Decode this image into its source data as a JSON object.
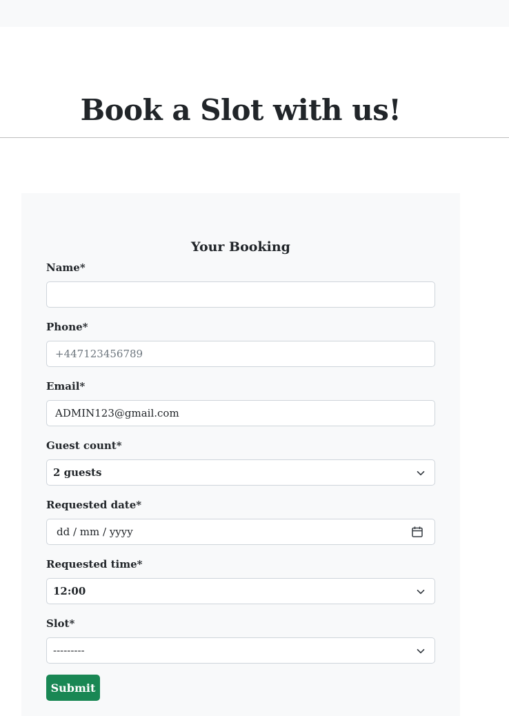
{
  "page": {
    "title": "Book a Slot with us!"
  },
  "booking_form": {
    "heading": "Your Booking",
    "fields": {
      "name": {
        "label": "Name*",
        "value": "",
        "placeholder": ""
      },
      "phone": {
        "label": "Phone*",
        "value": "",
        "placeholder": "+447123456789"
      },
      "email": {
        "label": "Email*",
        "value": "ADMIN123@gmail.com"
      },
      "guest_count": {
        "label": "Guest count*",
        "selected": "2 guests"
      },
      "requested_date": {
        "label": "Requested date*",
        "placeholder": "dd / mm / yyyy"
      },
      "requested_time": {
        "label": "Requested time*",
        "selected": "12:00"
      },
      "slot": {
        "label": "Slot*",
        "selected": "---------"
      }
    },
    "submit_label": "Submit"
  },
  "colors": {
    "submit_bg": "#198754",
    "card_bg": "#f8f9fa",
    "input_border": "#ced4da"
  },
  "icons": {
    "select_arrow": "chevron-down-icon",
    "date_picker": "calendar-icon"
  }
}
